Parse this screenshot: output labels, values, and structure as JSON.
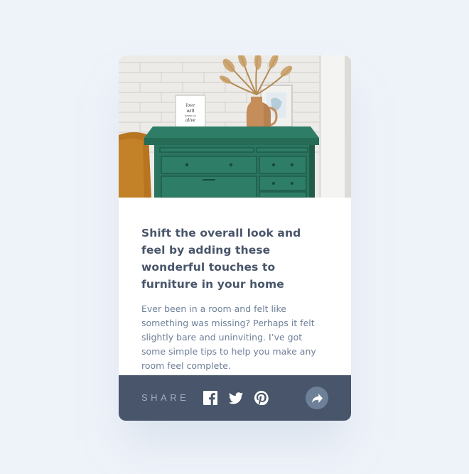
{
  "article": {
    "title": "Shift the overall look and feel by adding these wonderful touches to furniture in your home",
    "description": "Ever been in a room and felt like something was missing? Perhaps it felt slightly bare and uninviting. I’ve got some simple tips to help you make any room feel complete.",
    "image_alt": "Green drawer cabinet with vase and framed print",
    "frame_text": "love will keep us alive"
  },
  "share": {
    "label": "SHARE",
    "icons": [
      "facebook-icon",
      "twitter-icon",
      "pinterest-icon",
      "share-arrow-icon"
    ]
  },
  "colors": {
    "background": "#eef2f9",
    "title": "#48556a",
    "body_text": "#6e8098",
    "share_bar": "#48556a",
    "share_label": "#9eafc2",
    "share_button": "#6e8098"
  }
}
